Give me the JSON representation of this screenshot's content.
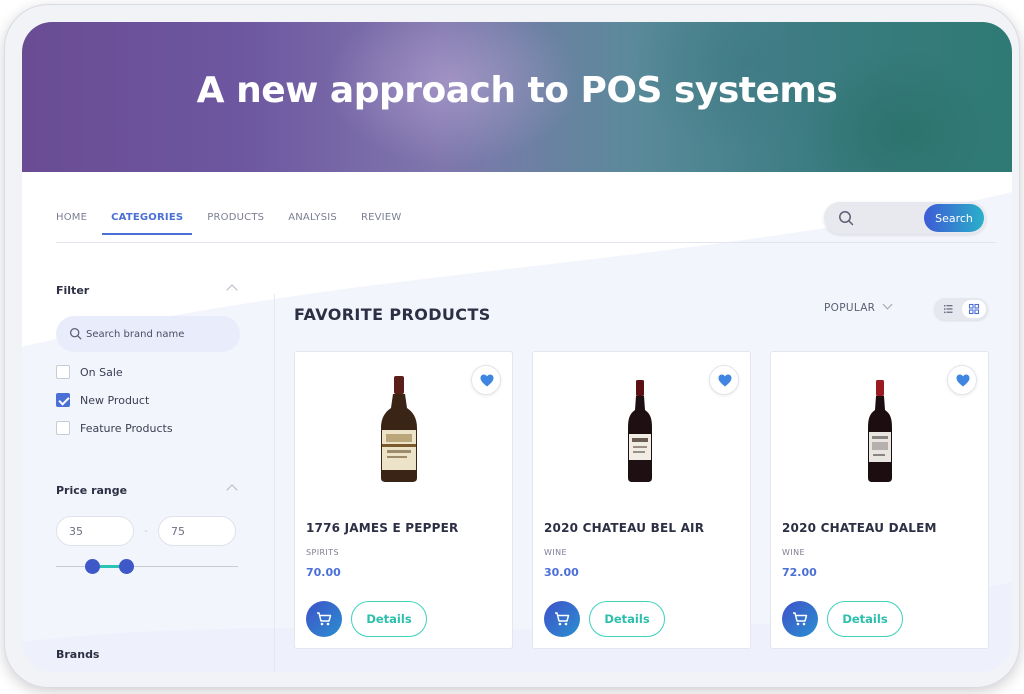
{
  "hero": {
    "title": "A new approach to POS systems"
  },
  "nav": {
    "items": [
      {
        "label": "HOME"
      },
      {
        "label": "CATEGORIES"
      },
      {
        "label": "PRODUCTS"
      },
      {
        "label": "ANALYSIS"
      },
      {
        "label": "REVIEW"
      }
    ],
    "active": "CATEGORIES"
  },
  "search": {
    "button_label": "Search",
    "icon": "search-icon"
  },
  "sidebar": {
    "filter_title": "Filter",
    "brand_search_placeholder": "Search brand name",
    "filters": [
      {
        "label": "On Sale",
        "checked": false
      },
      {
        "label": "New Product",
        "checked": true
      },
      {
        "label": "Feature Products",
        "checked": false
      }
    ],
    "price_title": "Price range",
    "price_min": "35",
    "price_max": "75",
    "price_separator": "-",
    "slider": {
      "range_min": 0,
      "range_max": 200,
      "low": 35,
      "high": 75
    },
    "brands_title": "Brands"
  },
  "main": {
    "title": "FAVORITE PRODUCTS",
    "sort_label": "POPULAR",
    "view_mode": "grid"
  },
  "products": [
    {
      "name": "1776 JAMES E PEPPER",
      "category": "SPIRITS",
      "price": "70.00",
      "details_label": "Details"
    },
    {
      "name": "2020 CHATEAU BEL AIR",
      "category": "WINE",
      "price": "30.00",
      "details_label": "Details"
    },
    {
      "name": "2020 CHATEAU DALEM",
      "category": "WINE",
      "price": "72.00",
      "details_label": "Details"
    }
  ],
  "colors": {
    "accent": "#4a6fd6",
    "teal": "#2bbfac",
    "favorite_heart": "#3f86e0"
  }
}
